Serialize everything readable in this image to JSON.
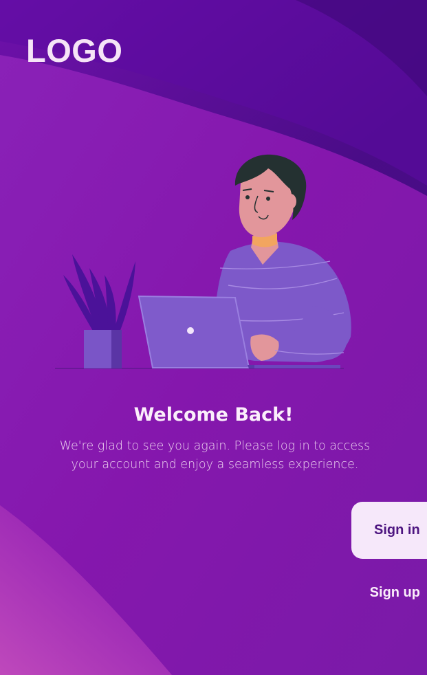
{
  "brand": {
    "logo_text": "LOGO"
  },
  "welcome": {
    "title": "Welcome Back!",
    "subtitle": "We're glad to see you again. Please log in to access your account and enjoy a seamless experience."
  },
  "actions": {
    "sign_in_label": "Sign in",
    "sign_up_label": "Sign up"
  },
  "colors": {
    "background_primary": "#8d1fb3",
    "background_dark": "#4a0a8c",
    "button_bg": "#f6e8fa",
    "button_text": "#4d1580",
    "text_light": "#fbeefb"
  }
}
